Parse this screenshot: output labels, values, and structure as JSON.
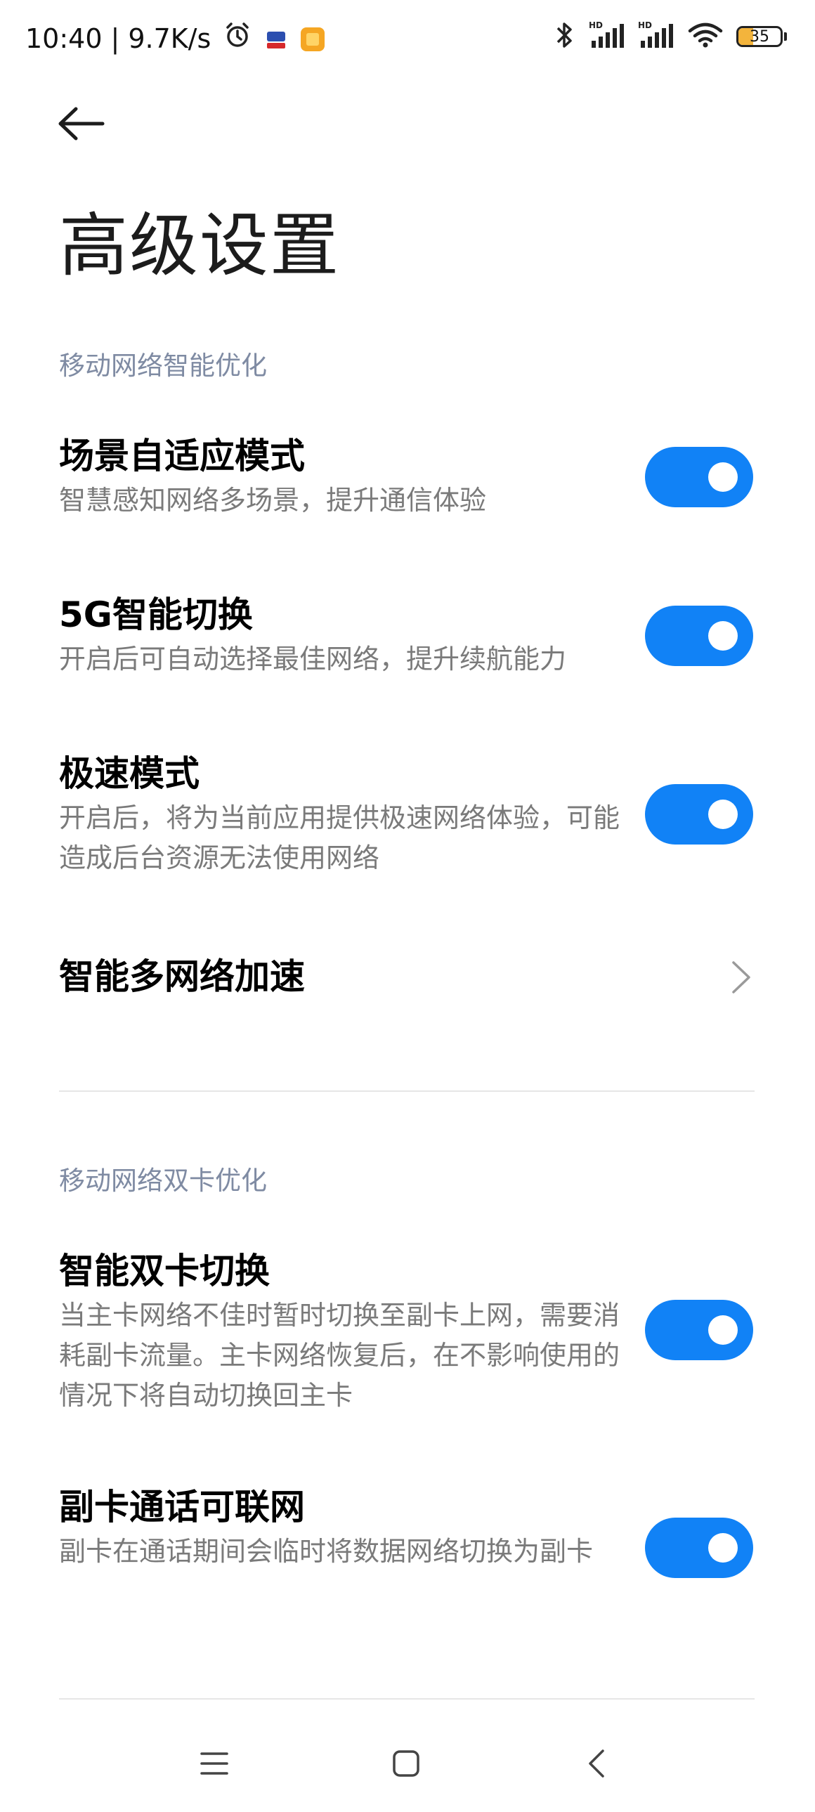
{
  "status_bar": {
    "time": "10:40",
    "separator": "|",
    "network_speed": "9.7K/s",
    "battery_level": "35",
    "battery_fraction": 0.35,
    "icons": [
      "alarm-icon",
      "app-icon-red",
      "app-icon-yellow",
      "bluetooth-icon",
      "signal-hd-1-icon",
      "signal-hd-2-icon",
      "wifi-icon",
      "battery-icon"
    ]
  },
  "header": {
    "title": "高级设置",
    "back_icon": "back-arrow-icon"
  },
  "sections": [
    {
      "header": "移动网络智能优化",
      "items": [
        {
          "title": "场景自适应模式",
          "desc": "智慧感知网络多场景，提升通信体验",
          "control": "toggle",
          "enabled": true
        },
        {
          "title": "5G智能切换",
          "desc": "开启后可自动选择最佳网络，提升续航能力",
          "control": "toggle",
          "enabled": true
        },
        {
          "title": "极速模式",
          "desc": "开启后，将为当前应用提供极速网络体验，可能造成后台资源无法使用网络",
          "control": "toggle",
          "enabled": true
        },
        {
          "title": "智能多网络加速",
          "desc": "",
          "control": "chevron"
        }
      ]
    },
    {
      "header": "移动网络双卡优化",
      "items": [
        {
          "title": "智能双卡切换",
          "desc": "当主卡网络不佳时暂时切换至副卡上网，需要消耗副卡流量。主卡网络恢复后，在不影响使用的情况下将自动切换回主卡",
          "control": "toggle",
          "enabled": true
        },
        {
          "title": "副卡通话可联网",
          "desc": "副卡在通话期间会临时将数据网络切换为副卡",
          "control": "toggle",
          "enabled": true
        }
      ]
    }
  ],
  "colors": {
    "accent": "#1182f6",
    "section_header": "#7f8ba3",
    "desc_text": "#7a7a7a",
    "battery": "#f3b43c"
  },
  "nav_bar": {
    "icons": [
      "menu-icon",
      "home-icon",
      "back-icon"
    ]
  }
}
